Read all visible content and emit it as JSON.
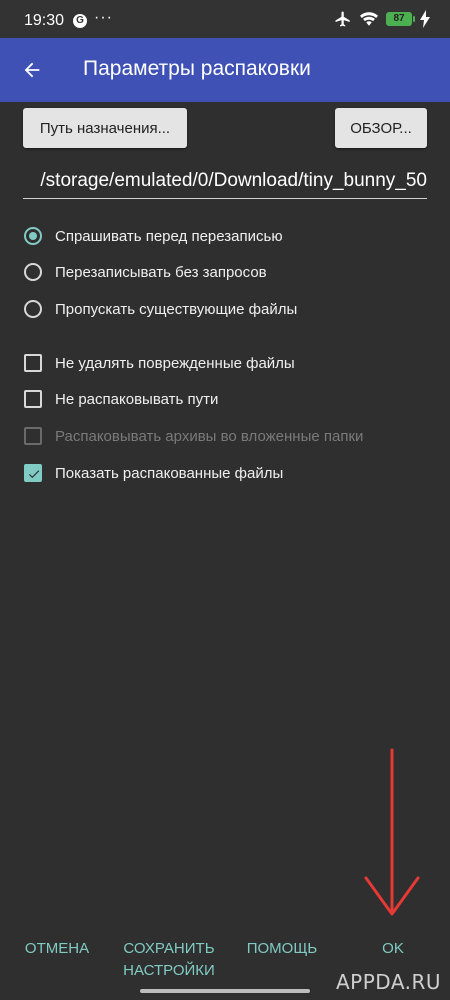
{
  "status_bar": {
    "time": "19:30",
    "g_badge": "G",
    "dots": "···",
    "battery": "87",
    "icons": [
      "airplane-icon",
      "wifi-icon",
      "battery-icon",
      "charging-icon"
    ]
  },
  "app_bar": {
    "title": "Параметры распаковки"
  },
  "buttons": {
    "destination_path": "Путь назначения...",
    "browse": "ОБЗОР..."
  },
  "path_input": {
    "value": "/storage/emulated/0/Download/tiny_bunny_50"
  },
  "overwrite_options": [
    {
      "label": "Спрашивать перед перезаписью",
      "selected": true
    },
    {
      "label": "Перезаписывать без запросов",
      "selected": false
    },
    {
      "label": "Пропускать существующие файлы",
      "selected": false
    }
  ],
  "checkbox_options": [
    {
      "label": "Не удалять поврежденные файлы",
      "checked": false,
      "disabled": false
    },
    {
      "label": "Не распаковывать пути",
      "checked": false,
      "disabled": false
    },
    {
      "label": "Распаковывать архивы во вложенные папки",
      "checked": false,
      "disabled": true
    },
    {
      "label": "Показать распакованные файлы",
      "checked": true,
      "disabled": false
    }
  ],
  "bottom_buttons": {
    "cancel": "ОТМЕНА",
    "save_line1": "СОХРАНИТЬ",
    "save_line2": "НАСТРОЙКИ",
    "help": "ПОМОЩЬ",
    "ok": "OK"
  },
  "watermark": "APPDA.RU",
  "colors": {
    "app_bar": "#3f51b5",
    "accent": "#80cbc4",
    "background": "#2f2f2f",
    "annotation_arrow": "#e53935"
  }
}
